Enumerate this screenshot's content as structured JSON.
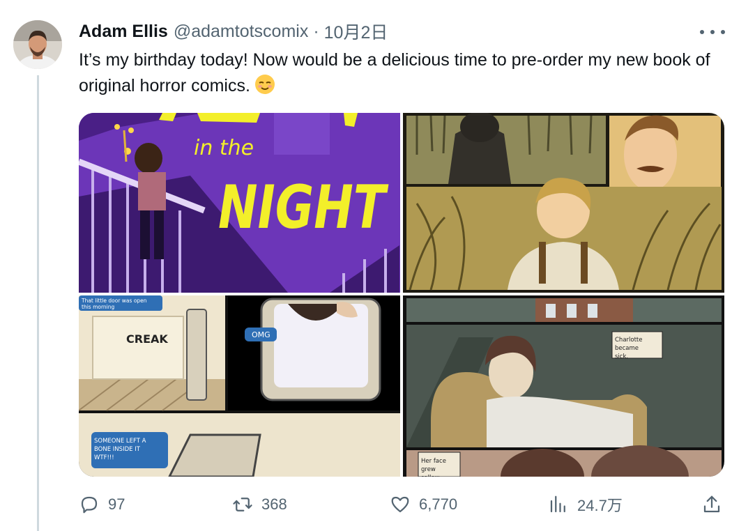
{
  "tweet": {
    "display_name": "Adam Ellis",
    "handle": "@adamtotscomix",
    "separator": "·",
    "date": "10月2日",
    "text": "It’s my birthday today! Now would be a delicious time to pre-order my new book of original horror comics.",
    "emoji": "relieved-face",
    "media": {
      "cover_title_line1": "in the",
      "cover_title_line2": "NIGHT",
      "bubble_top": "That little door was open this morning",
      "sound_effect": "CREAK",
      "bubble_omg": "OMG",
      "bubble_bone": "SOMEONE LEFT A BONE INSIDE IT WTF!!!",
      "caption_charlotte": "Charlotte became sick.",
      "caption_face": "Her face grew sallow."
    },
    "actions": {
      "replies": "97",
      "retweets": "368",
      "likes": "6,770",
      "views": "24.7万"
    }
  },
  "colors": {
    "text": "#0f1419",
    "secondary": "#536471",
    "thread_line": "#cfd9de"
  }
}
